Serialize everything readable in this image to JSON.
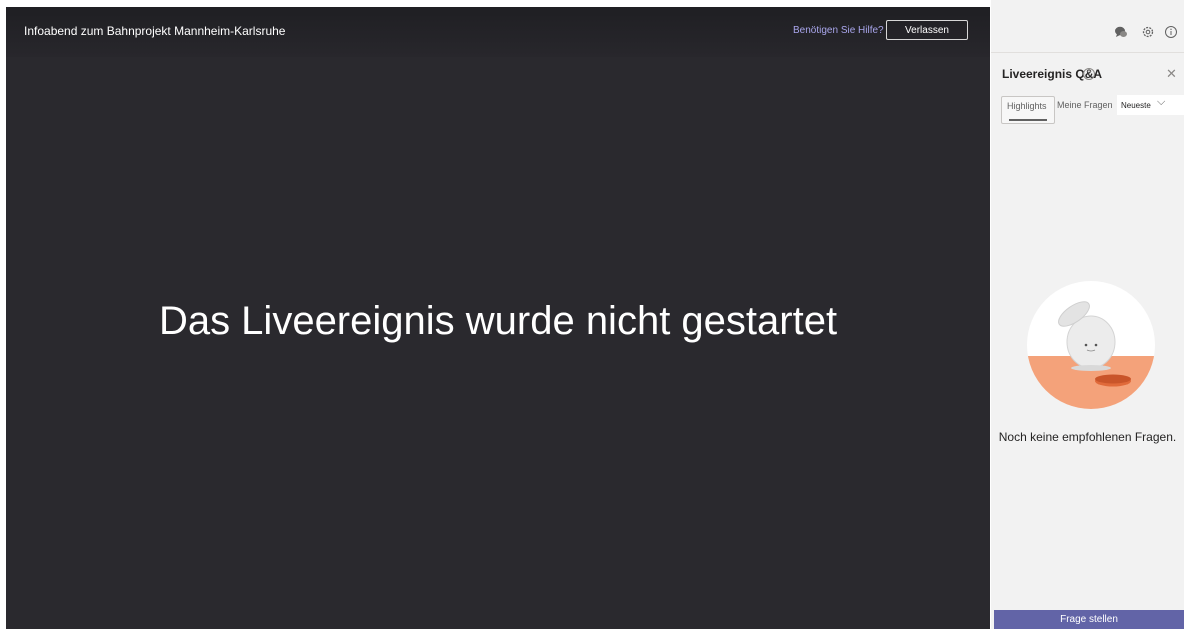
{
  "stage": {
    "event_title": "Infoabend zum Bahnprojekt Mannheim-Karlsruhe",
    "help_link": "Benötigen Sie Hilfe?",
    "leave_button": "Verlassen",
    "status_message": "Das Liveereignis wurde nicht gestartet"
  },
  "panel": {
    "top_icons": [
      "chat-bubbles-icon",
      "gear-icon",
      "info-icon"
    ],
    "title": "Liveereignis Q&A",
    "tabs": [
      {
        "label": "Highlights",
        "selected": true
      },
      {
        "label": "Meine Fragen",
        "selected": false
      }
    ],
    "sort": {
      "selected": "Neueste"
    },
    "empty_state": "Noch keine empfohlenen Fragen.",
    "ask_button": "Frage stellen"
  },
  "colors": {
    "stage_bg": "#2a292e",
    "panel_bg": "#f2f2f2",
    "accent": "#6264a7",
    "link": "#a9a6ec",
    "illustration_orange": "#f4a27a"
  }
}
